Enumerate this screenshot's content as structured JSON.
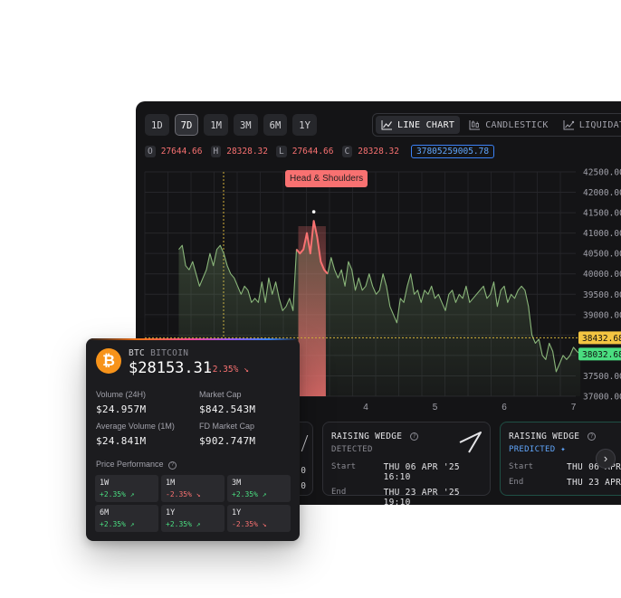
{
  "toolbar": {
    "timeframes": [
      {
        "label": "1D",
        "active": false
      },
      {
        "label": "7D",
        "active": true
      },
      {
        "label": "1M",
        "active": false
      },
      {
        "label": "3M",
        "active": false
      },
      {
        "label": "6M",
        "active": false
      },
      {
        "label": "1Y",
        "active": false
      }
    ],
    "modes": [
      {
        "label": "LINE CHART",
        "icon": "line-chart-icon",
        "active": true
      },
      {
        "label": "CANDLESTICK",
        "icon": "candlestick-icon",
        "active": false
      },
      {
        "label": "LIQUIDATION",
        "icon": "liquidation-chart-icon",
        "active": false
      }
    ]
  },
  "ohlc": {
    "o_key": "O",
    "o": "27644.66",
    "h_key": "H",
    "h": "28328.32",
    "l_key": "L",
    "l": "27644.66",
    "c_key": "C",
    "c": "28328.32",
    "volume": "37805259005.78"
  },
  "pattern_badge": "Head & Shoulders",
  "chart_data": {
    "type": "area",
    "x": [
      1.3,
      1.35,
      1.4,
      1.45,
      1.5,
      1.55,
      1.6,
      1.65,
      1.7,
      1.75,
      1.8,
      1.85,
      1.9,
      1.95,
      2.0,
      2.05,
      2.1,
      2.15,
      2.2,
      2.25,
      2.3,
      2.35,
      2.4,
      2.45,
      2.5,
      2.55,
      2.6,
      2.65,
      2.7,
      2.75,
      2.8,
      2.85,
      2.9,
      2.95,
      3.0,
      3.05,
      3.1,
      3.15,
      3.2,
      3.25,
      3.3,
      3.35,
      3.4,
      3.45,
      3.5,
      3.55,
      3.6,
      3.65,
      3.7,
      3.75,
      3.8,
      3.85,
      3.9,
      3.95,
      4.0,
      4.05,
      4.1,
      4.15,
      4.2,
      4.25,
      4.3,
      4.35,
      4.4,
      4.45,
      4.5,
      4.55,
      4.6,
      4.65,
      4.7,
      4.75,
      4.8,
      4.85,
      4.9,
      4.95,
      5.0,
      5.05,
      5.1,
      5.15,
      5.2,
      5.25,
      5.3,
      5.35,
      5.4,
      5.45,
      5.5,
      5.55,
      5.6,
      5.65,
      5.7,
      5.75,
      5.8,
      5.85,
      5.9,
      5.95,
      6.0,
      6.05,
      6.1,
      6.15,
      6.2,
      6.25,
      6.3,
      6.35,
      6.4,
      6.45,
      6.5,
      6.55,
      6.6,
      6.65,
      6.7,
      6.75,
      6.8,
      6.85,
      6.9,
      6.95,
      7.0,
      7.05,
      7.1
    ],
    "y": [
      40600,
      40700,
      40200,
      40100,
      40300,
      40000,
      39700,
      39900,
      40100,
      40500,
      40200,
      40600,
      40700,
      40500,
      40200,
      40000,
      39900,
      39700,
      39500,
      39700,
      39600,
      39300,
      39400,
      39300,
      39800,
      39300,
      39900,
      39500,
      39800,
      39400,
      39100,
      39200,
      39400,
      39100,
      40600,
      40500,
      40600,
      41000,
      40500,
      41300,
      40900,
      40300,
      40100,
      40000,
      40400,
      40100,
      39900,
      40100,
      39700,
      40300,
      40100,
      39600,
      39900,
      39600,
      39700,
      40000,
      39700,
      39500,
      39600,
      40000,
      39700,
      39200,
      39000,
      38800,
      39400,
      39300,
      39700,
      40000,
      39500,
      39600,
      39300,
      39600,
      39500,
      39700,
      39400,
      39500,
      39300,
      39100,
      39500,
      39600,
      39300,
      39500,
      39400,
      39700,
      39300,
      39400,
      39500,
      39600,
      39700,
      39400,
      39500,
      39800,
      39200,
      39600,
      39700,
      39300,
      39500,
      39400,
      39600,
      39700,
      39600,
      39200,
      38500,
      38300,
      38400,
      38000,
      37900,
      38300,
      38100,
      37600,
      37800,
      38000,
      37900,
      38000,
      38200,
      38100,
      38032
    ],
    "ylim": [
      37000,
      42500
    ],
    "yticks": [
      "37000.00",
      "37500.00",
      "38000.00",
      "38500.00",
      "39000.00",
      "39500.00",
      "40000.00",
      "40500.00",
      "41000.00",
      "41500.00",
      "42000.00",
      "42500.00"
    ],
    "xticks": [
      "4",
      "5",
      "6",
      "7"
    ],
    "price_labels": [
      {
        "value": 38432.68,
        "text": "38432.68",
        "color": "#f4c542"
      },
      {
        "value": 38032.68,
        "text": "38032.68",
        "color": "#4ade80"
      }
    ],
    "pattern_range": [
      3.0,
      3.45
    ],
    "series_color": "#8ab67a",
    "pattern_color": "#f87171"
  },
  "patterns": [
    {
      "title": "RAISING WEDGE",
      "status": "DETECTED",
      "predicted": false,
      "start_label": "Start",
      "start": "THU 06 APR '25 16:10",
      "end_label": "End",
      "end": "THU 23 APR '25 19:10"
    },
    {
      "title": "RAISING WEDGE",
      "status": "PREDICTED",
      "predicted": true,
      "start_label": "Start",
      "start": "THU 06 APR",
      "end_label": "End",
      "end": "THU 23 APR"
    }
  ],
  "btc": {
    "symbol": "BTC",
    "name": "BITCOIN",
    "price": "$28153.31",
    "change": "-2.35%",
    "volume_label": "Volume (24H)",
    "volume": "$24.957M",
    "mcap_label": "Market Cap",
    "mcap": "$842.543M",
    "avgvol_label": "Average Volume (1M)",
    "avgvol": "$24.841M",
    "fdmc_label": "FD Market Cap",
    "fdmc": "$902.747M",
    "perf_title": "Price Performance",
    "performance": [
      {
        "period": "1W",
        "change": "+2.35%",
        "positive": true
      },
      {
        "period": "1M",
        "change": "-2.35%",
        "positive": false
      },
      {
        "period": "3M",
        "change": "+2.35%",
        "positive": true
      },
      {
        "period": "6M",
        "change": "+2.35%",
        "positive": true
      },
      {
        "period": "1Y",
        "change": "+2.35%",
        "positive": true
      },
      {
        "period": "1Y",
        "change": "-2.35%",
        "positive": false
      }
    ]
  }
}
